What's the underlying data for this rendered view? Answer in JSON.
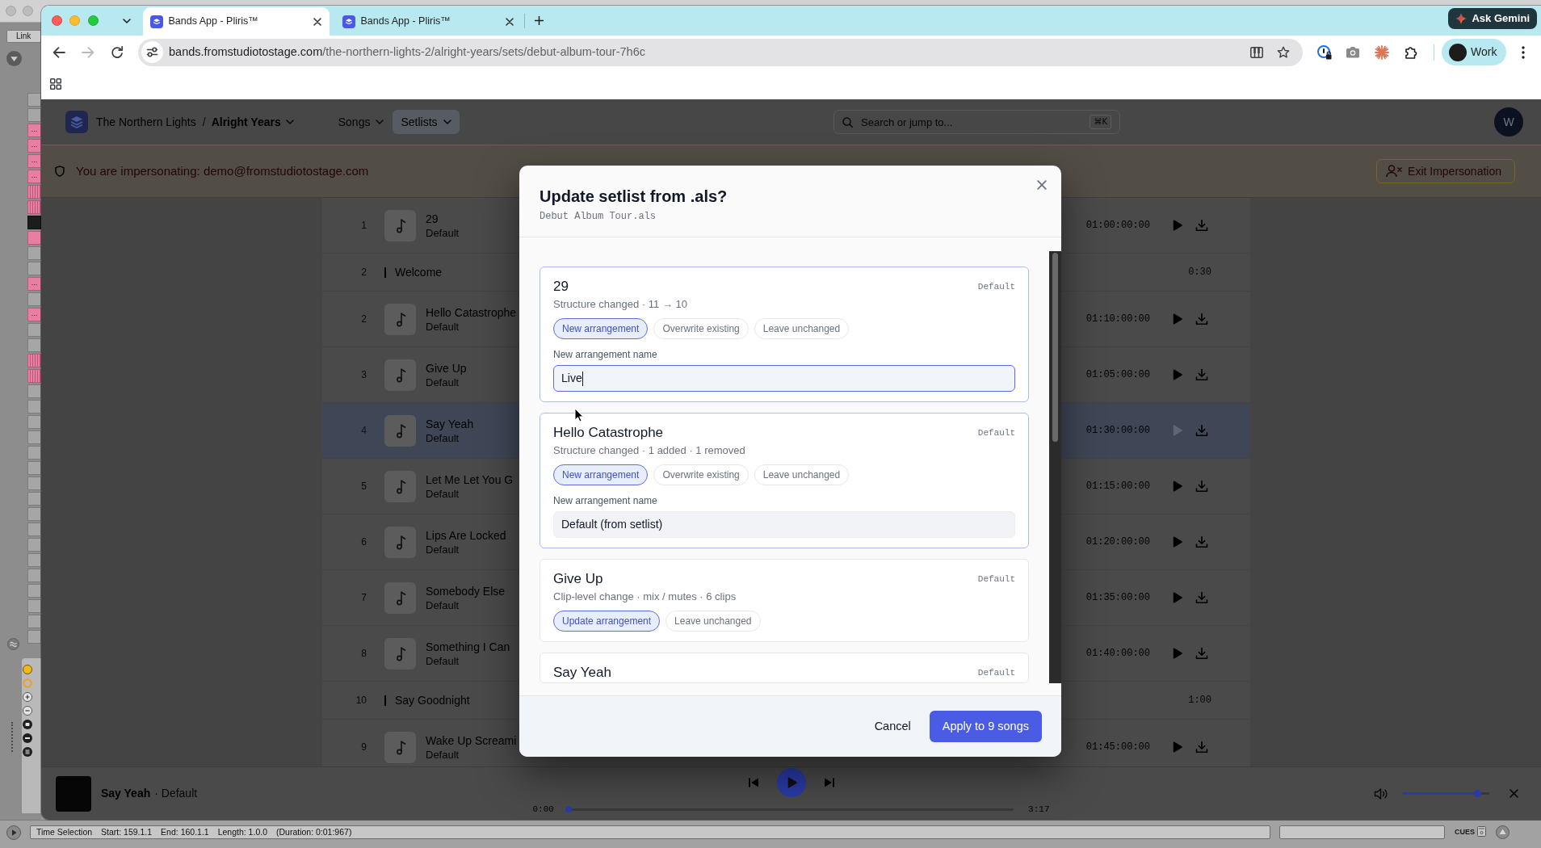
{
  "daw": {
    "link_button": "Link",
    "clip_slots": [
      {
        "kind": "empty"
      },
      {
        "kind": "empty"
      },
      {
        "kind": "clip",
        "label": "..."
      },
      {
        "kind": "clip",
        "label": "..."
      },
      {
        "kind": "clip",
        "label": "..."
      },
      {
        "kind": "clip",
        "label": "..."
      },
      {
        "kind": "striped"
      },
      {
        "kind": "striped"
      },
      {
        "kind": "dark"
      },
      {
        "kind": "clip"
      },
      {
        "kind": "empty"
      },
      {
        "kind": "empty"
      },
      {
        "kind": "clip",
        "label": "..."
      },
      {
        "kind": "empty"
      },
      {
        "kind": "clip",
        "label": "..."
      },
      {
        "kind": "empty"
      },
      {
        "kind": "empty"
      },
      {
        "kind": "striped"
      },
      {
        "kind": "striped"
      },
      {
        "kind": "empty"
      },
      {
        "kind": "empty"
      },
      {
        "kind": "empty"
      },
      {
        "kind": "empty"
      },
      {
        "kind": "empty"
      },
      {
        "kind": "empty"
      },
      {
        "kind": "empty"
      },
      {
        "kind": "empty"
      },
      {
        "kind": "empty"
      },
      {
        "kind": "empty"
      },
      {
        "kind": "empty"
      },
      {
        "kind": "empty"
      },
      {
        "kind": "empty"
      },
      {
        "kind": "empty"
      },
      {
        "kind": "empty"
      },
      {
        "kind": "empty"
      },
      {
        "kind": "empty"
      }
    ],
    "status_bar": {
      "segments": [
        "Time Selection",
        "Start: 159.1.1",
        "End: 160.1.1",
        "Length: 1.0.0",
        "(Duration: 0:01:967)"
      ],
      "cues_label": "CUES"
    }
  },
  "browser": {
    "tabs": [
      {
        "title": "Bands App - Pliris™",
        "selected": true
      },
      {
        "title": "Bands App - Pliris™",
        "selected": false
      }
    ],
    "ask_button": "Ask Gemini",
    "navigation": {
      "back_disabled": false,
      "forward_disabled": true
    },
    "address_bar": {
      "host": "bands.fromstudiotostage.com",
      "path": "/the-northern-lights-2/alright-years/sets/debut-album-tour-7h6c"
    },
    "profile_button": "Work"
  },
  "app": {
    "header": {
      "breadcrumb": [
        "The Northern Lights",
        "Alright Years"
      ],
      "breadcrumb_separator": "/",
      "nav": [
        {
          "label": "Songs",
          "selected": false
        },
        {
          "label": "Setlists",
          "selected": true
        }
      ],
      "search": {
        "placeholder": "Search or jump to...",
        "shortcut": "⌘K"
      },
      "avatar": "W"
    },
    "impersonation_banner": {
      "message": "You are impersonating: demo@fromstudiotostage.com",
      "exit_button": "Exit Impersonation"
    },
    "setlist": [
      {
        "kind": "song",
        "number": "1",
        "title": "29",
        "arrangement": "Default",
        "timecode": "01:00:00:00",
        "selected": false
      },
      {
        "kind": "section",
        "number": "2",
        "title": "Welcome",
        "duration": "0:30"
      },
      {
        "kind": "song",
        "number": "2",
        "title": "Hello Catastrophe",
        "arrangement": "Default",
        "timecode": "01:10:00:00",
        "selected": false
      },
      {
        "kind": "song",
        "number": "3",
        "title": "Give Up",
        "arrangement": "Default",
        "timecode": "01:05:00:00",
        "selected": false
      },
      {
        "kind": "song",
        "number": "4",
        "title": "Say Yeah",
        "arrangement": "Default",
        "timecode": "01:30:00:00",
        "selected": true
      },
      {
        "kind": "song",
        "number": "5",
        "title": "Let Me Let You G",
        "arrangement": "Default",
        "timecode": "01:15:00:00",
        "selected": false
      },
      {
        "kind": "song",
        "number": "6",
        "title": "Lips Are Locked",
        "arrangement": "Default",
        "timecode": "01:20:00:00",
        "selected": false
      },
      {
        "kind": "song",
        "number": "7",
        "title": "Somebody Else",
        "arrangement": "Default",
        "timecode": "01:35:00:00",
        "selected": false
      },
      {
        "kind": "song",
        "number": "8",
        "title": "Something I Can",
        "arrangement": "Default",
        "timecode": "01:40:00:00",
        "selected": false
      },
      {
        "kind": "section",
        "number": "10",
        "title": "Say Goodnight",
        "duration": "1:00"
      },
      {
        "kind": "song",
        "number": "9",
        "title": "Wake Up Screami",
        "arrangement": "Default",
        "timecode": "01:45:00:00",
        "selected": false
      }
    ],
    "player": {
      "title": "Say Yeah",
      "subtitle": "· Default",
      "elapsed": "0:00",
      "duration": "3:17",
      "progress": {
        "level": 0
      },
      "volume": {
        "level": 0.87
      }
    }
  },
  "dialog": {
    "title": "Update setlist from .als?",
    "file": "Debut Album Tour.als",
    "songs": [
      {
        "title": "29",
        "arrangement": "Default",
        "summary": "Structure changed · 11 → 10",
        "highlighted": true,
        "options": [
          {
            "label": "New arrangement",
            "selected": true
          },
          {
            "label": "Overwrite existing",
            "selected": false
          },
          {
            "label": "Leave unchanged",
            "selected": false
          }
        ],
        "name_field": {
          "label": "New arrangement name",
          "value": "Live",
          "focused": true
        }
      },
      {
        "title": "Hello Catastrophe",
        "arrangement": "Default",
        "summary": "Structure changed · 1 added · 1 removed",
        "highlighted": true,
        "options": [
          {
            "label": "New arrangement",
            "selected": true
          },
          {
            "label": "Overwrite existing",
            "selected": false
          },
          {
            "label": "Leave unchanged",
            "selected": false
          }
        ],
        "name_field": {
          "label": "New arrangement name",
          "value": "Default (from setlist)",
          "focused": false
        }
      },
      {
        "title": "Give Up",
        "arrangement": "Default",
        "summary": "Clip-level change · mix / mutes · 6 clips",
        "highlighted": false,
        "options": [
          {
            "label": "Update arrangement",
            "selected": true
          },
          {
            "label": "Leave unchanged",
            "selected": false
          }
        ]
      },
      {
        "title": "Say Yeah",
        "arrangement": "Default",
        "highlighted": false
      }
    ],
    "cancel_button": "Cancel",
    "apply_button": "Apply to 9 songs"
  }
}
